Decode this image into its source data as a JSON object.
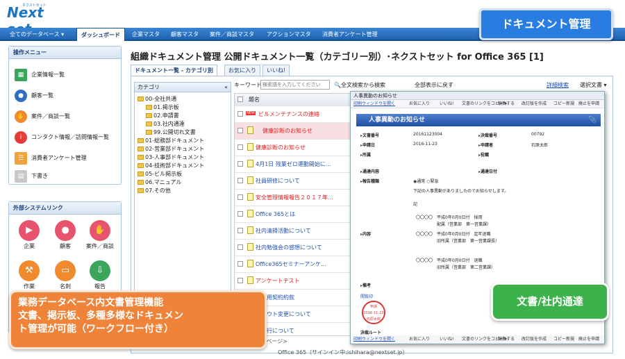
{
  "logo": {
    "text": "Next set",
    "sub": "ネクストセット"
  },
  "nav": [
    "全てのデータベース ▾",
    "ダッシュボード",
    "企業マスタ",
    "顧客マスタ",
    "案件／商談マスタ",
    "アクションマスタ",
    "消費者アンケート管理"
  ],
  "sidebar": {
    "menu_title": "操作メニュー",
    "menu": [
      "企業情報一覧",
      "顧客一覧",
      "案件／商談一覧",
      "コンタクト情報／訪問情報一覧",
      "消費者アンケート管理",
      "下書き"
    ],
    "ext_title": "外部システムリンク",
    "ext": [
      "企業",
      "顧客",
      "案件／商談",
      "作業",
      "名刺",
      "報告"
    ]
  },
  "page_title": "組織ドキュメント管理 公開ドキュメント一覧（カテゴリー別）･ネクストセット for Office 365 [1]",
  "tabs": [
    "ドキュメント一覧 - カテゴリ別",
    "お気に入り",
    "いいね!"
  ],
  "category": {
    "header": "カテゴリ",
    "collapse": "«",
    "nodes": [
      "00-全社共通",
      "01.掲示板",
      "02.申請書",
      "03.社内通達",
      "99.公開切れ文書",
      "01-総務部ドキュメント",
      "02-営業部ドキュメント",
      "03-人事部ドキュメント",
      "04-技術部ドキュメント",
      "05-ビル掲示板",
      "06.マニュアル",
      "07.その他"
    ]
  },
  "search": {
    "label": "キーワード:",
    "placeholder": "検索語を入力してください",
    "search_btn": "全文検索から検索",
    "show_all": "全部表示に戻す",
    "detail": "詳細検索",
    "select": "選択文書 ▾"
  },
  "list": {
    "header": "題名",
    "rows": [
      "ビルメンテナンスの連絡",
      "健康診断のお知らせ",
      "健康診断のお知らせ",
      "4月1日 残業ゼロ運動開始に...",
      "社員研修について",
      "安全管理情報報告２０１７年...",
      "Office 365とは",
      "社内清掃活動について",
      "社内勉強会の感想について",
      "Office365セミナーアンケ...",
      "アンケートテスト",
      "ご利用契約約款",
      "ウアウト変更について",
      "員旅行について"
    ],
    "new": "NEW"
  },
  "pager": "ページ 次ページ>",
  "doc": {
    "window_title": "人事異動のお知らせ",
    "toolbar": [
      "印刷ウィンドウを開く",
      "お気に入り",
      "いいね!",
      "文書のリンクをコピー ▾",
      "編集する",
      "改訂版を作成",
      "コピー新規",
      "廃止を申請"
    ],
    "notice": "人事異動のお知らせ",
    "labels": {
      "docno": "文書番号",
      "approval": "決裁番号",
      "applied": "申請日",
      "applicant": "申請者",
      "dept": "所属",
      "role": "役職",
      "dest": "通達内容",
      "date": "通達日付",
      "type": "報告種類",
      "content": "内容",
      "remark": "備考",
      "approval_stamp": "閲覧印",
      "route": "決裁ルート"
    },
    "values": {
      "docno": "20161123004",
      "approval": "00792",
      "applied": "2016-11-23",
      "applicant": "石原太郎",
      "type_normal": "通常",
      "type_urgent": "緊急"
    },
    "body": [
      "下記の人事異動がありましたのでお知らせします。",
      "記",
      "〇〇〇〇　平成0年0月0日付　採用",
      "配属（営業部　第一営業課）",
      "〇〇〇〇　平成0年0月0日付　定年退職",
      "旧所属（営業部　第一営業課長）",
      "〇〇〇〇　平成0年0月0日付　退職",
      "旧所属（営業部　第二営業課）"
    ],
    "stamp": [
      "申請",
      "2016-11-23",
      "石原太郎"
    ]
  },
  "badges": {
    "doc_mgmt": "ドキュメント管理",
    "circular": "文書/社内通達"
  },
  "callout": [
    "業務データベース内文書管理機能",
    "文書、掲示板、多種多様なドキュメン",
    "ト管理が可能（ワークフロー付き）"
  ],
  "footer": "Office 365（サインイン中:ishihara@nextset.jp）"
}
